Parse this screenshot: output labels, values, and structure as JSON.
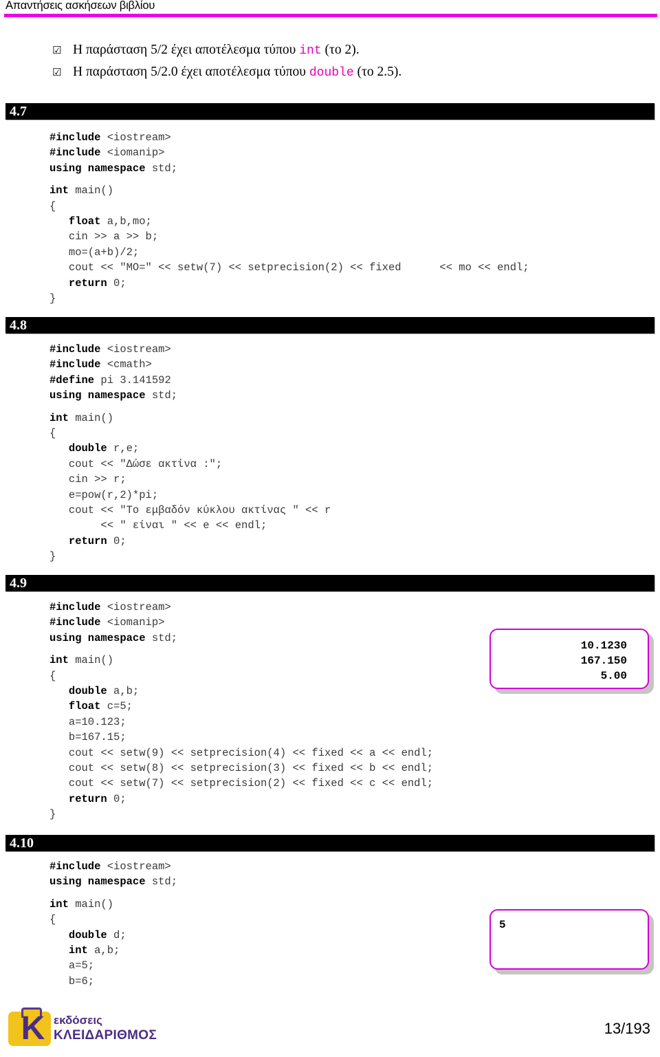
{
  "header": {
    "title": "Απαντήσεις ασκήσεων βιβλίου",
    "rule_color": "#ec00ec"
  },
  "intro_list": {
    "bullet_glyph": "☑",
    "items": [
      {
        "before": "Η παράσταση 5/2 έχει αποτέλεσμα τύπου ",
        "type": "int",
        "after": " (το 2)."
      },
      {
        "before": "Η παράσταση 5/2.0 έχει αποτέλεσμα τύπου ",
        "type": "double",
        "after": " (το 2.5)."
      }
    ],
    "type_color": "#e700b8"
  },
  "sections": [
    {
      "label": "4.7",
      "code_lines": [
        [
          {
            "t": "#include",
            "b": true
          },
          {
            "t": " <iostream>",
            "b": false
          }
        ],
        [
          {
            "t": "#include",
            "b": true
          },
          {
            "t": " <iomanip>",
            "b": false
          }
        ],
        [
          {
            "t": "using namespace",
            "b": true
          },
          {
            "t": " std;",
            "b": false
          }
        ],
        [
          {
            "t": "",
            "b": false
          }
        ],
        [
          {
            "t": "int",
            "b": true
          },
          {
            "t": " main()",
            "b": false
          }
        ],
        [
          {
            "t": "{",
            "b": false
          }
        ],
        [
          {
            "t": "   ",
            "b": false
          },
          {
            "t": "float",
            "b": true
          },
          {
            "t": " a,b,mo;",
            "b": false
          }
        ],
        [
          {
            "t": "   cin >> a >> b;",
            "b": false
          }
        ],
        [
          {
            "t": "   mo=(a+b)/2;",
            "b": false
          }
        ],
        [
          {
            "t": "   cout << \"MO=\" << setw(7) << setprecision(2) << fixed      << mo << endl;",
            "b": false
          }
        ],
        [
          {
            "t": "   ",
            "b": false
          },
          {
            "t": "return",
            "b": true
          },
          {
            "t": " 0;",
            "b": false
          }
        ],
        [
          {
            "t": "}",
            "b": false
          }
        ]
      ],
      "output": null
    },
    {
      "label": "4.8",
      "code_lines": [
        [
          {
            "t": "#include",
            "b": true
          },
          {
            "t": " <iostream>",
            "b": false
          }
        ],
        [
          {
            "t": "#include",
            "b": true
          },
          {
            "t": " <cmath>",
            "b": false
          }
        ],
        [
          {
            "t": "#define",
            "b": true
          },
          {
            "t": " pi 3.141592",
            "b": false
          }
        ],
        [
          {
            "t": "using namespace",
            "b": true
          },
          {
            "t": " std;",
            "b": false
          }
        ],
        [
          {
            "t": "",
            "b": false
          }
        ],
        [
          {
            "t": "int",
            "b": true
          },
          {
            "t": " main()",
            "b": false
          }
        ],
        [
          {
            "t": "{",
            "b": false
          }
        ],
        [
          {
            "t": "   ",
            "b": false
          },
          {
            "t": "double",
            "b": true
          },
          {
            "t": " r,e;",
            "b": false
          }
        ],
        [
          {
            "t": "   cout << \"Δώσε ακτίνα :\";",
            "b": false
          }
        ],
        [
          {
            "t": "   cin >> r;",
            "b": false
          }
        ],
        [
          {
            "t": "   e=pow(r,2)*pi;",
            "b": false
          }
        ],
        [
          {
            "t": "   cout << \"Το εμβαδόν κύκλου ακτίνας \" << r",
            "b": false
          }
        ],
        [
          {
            "t": "        << \" είναι \" << e << endl;",
            "b": false
          }
        ],
        [
          {
            "t": "   ",
            "b": false
          },
          {
            "t": "return",
            "b": true
          },
          {
            "t": " 0;",
            "b": false
          }
        ],
        [
          {
            "t": "}",
            "b": false
          }
        ]
      ],
      "output": null
    },
    {
      "label": "4.9",
      "code_lines": [
        [
          {
            "t": "#include",
            "b": true
          },
          {
            "t": " <iostream>",
            "b": false
          }
        ],
        [
          {
            "t": "#include",
            "b": true
          },
          {
            "t": " <iomanip>",
            "b": false
          }
        ],
        [
          {
            "t": "using namespace",
            "b": true
          },
          {
            "t": " std;",
            "b": false
          }
        ],
        [
          {
            "t": "",
            "b": false
          }
        ],
        [
          {
            "t": "int",
            "b": true
          },
          {
            "t": " main()",
            "b": false
          }
        ],
        [
          {
            "t": "{",
            "b": false
          }
        ],
        [
          {
            "t": "   ",
            "b": false
          },
          {
            "t": "double",
            "b": true
          },
          {
            "t": " a,b;",
            "b": false
          }
        ],
        [
          {
            "t": "   ",
            "b": false
          },
          {
            "t": "float",
            "b": true
          },
          {
            "t": " c=5;",
            "b": false
          }
        ],
        [
          {
            "t": "   a=10.123;",
            "b": false
          }
        ],
        [
          {
            "t": "   b=167.15;",
            "b": false
          }
        ],
        [
          {
            "t": "   cout << setw(9) << setprecision(4) << fixed << a << endl;",
            "b": false
          }
        ],
        [
          {
            "t": "   cout << setw(8) << setprecision(3) << fixed << b << endl;",
            "b": false
          }
        ],
        [
          {
            "t": "   cout << setw(7) << setprecision(2) << fixed << c << endl;",
            "b": false
          }
        ],
        [
          {
            "t": "   ",
            "b": false
          },
          {
            "t": "return",
            "b": true
          },
          {
            "t": " 0;",
            "b": false
          }
        ],
        [
          {
            "t": "}",
            "b": false
          }
        ]
      ],
      "output": "  10.1230\n 167.150\n     5.00"
    },
    {
      "label": "4.10",
      "code_lines": [
        [
          {
            "t": "#include",
            "b": true
          },
          {
            "t": " <iostream>",
            "b": false
          }
        ],
        [
          {
            "t": "using namespace",
            "b": true
          },
          {
            "t": " std;",
            "b": false
          }
        ],
        [
          {
            "t": "",
            "b": false
          }
        ],
        [
          {
            "t": "int",
            "b": true
          },
          {
            "t": " main()",
            "b": false
          }
        ],
        [
          {
            "t": "{",
            "b": false
          }
        ],
        [
          {
            "t": "   ",
            "b": false
          },
          {
            "t": "double",
            "b": true
          },
          {
            "t": " d;",
            "b": false
          }
        ],
        [
          {
            "t": "   ",
            "b": false
          },
          {
            "t": "int",
            "b": true
          },
          {
            "t": " a,b;",
            "b": false
          }
        ],
        [
          {
            "t": "   a=5;",
            "b": false
          }
        ],
        [
          {
            "t": "   b=6;",
            "b": false
          }
        ]
      ],
      "output": "5"
    }
  ],
  "footer": {
    "logo_letter": "K",
    "logo_line1": "εκδόσεις",
    "logo_line2": "ΚΛΕΙΔΑΡΙΘΜΟΣ",
    "logo_bg_color": "#f2c31b",
    "logo_fg_color": "#4a2d85",
    "page_number": "13/193"
  }
}
